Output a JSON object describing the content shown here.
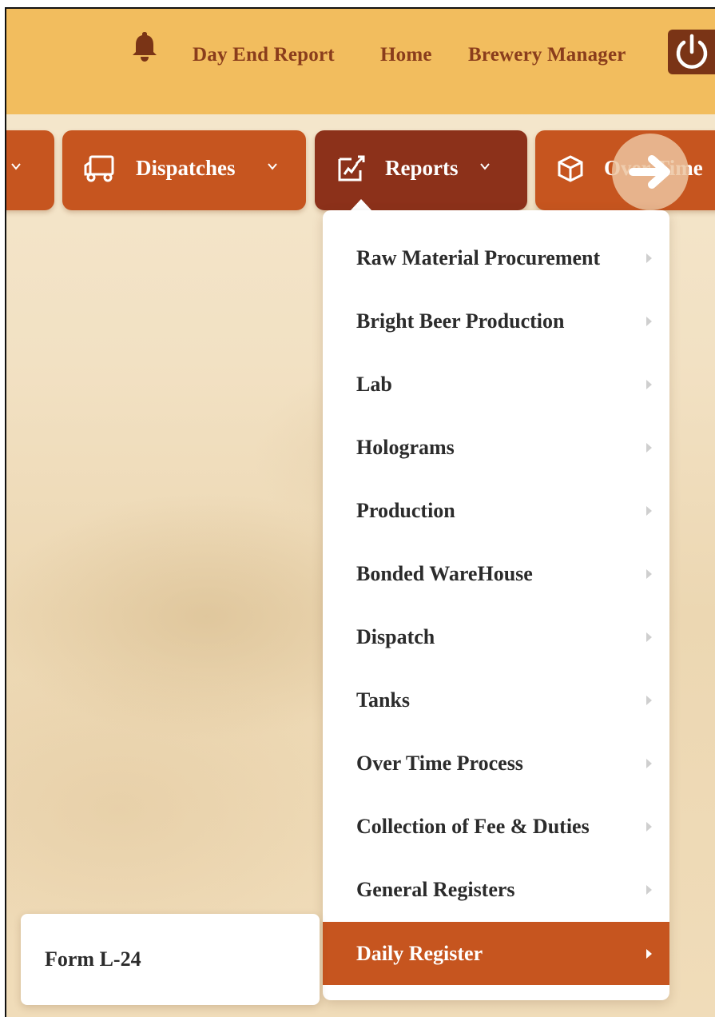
{
  "header": {
    "links": [
      "Day End Report",
      "Home",
      "Brewery Manager"
    ],
    "icons": [
      "bell-icon",
      "power-icon"
    ],
    "accent": "#f2bd5e",
    "brand": "#7a3416"
  },
  "navbar": {
    "items": [
      {
        "label": "Dispatches",
        "icon": "truck-icon"
      },
      {
        "label": "Reports",
        "icon": "chart-edit-icon"
      },
      {
        "label": "Over Time",
        "icon": "box-icon"
      }
    ],
    "active": "Reports",
    "button_color": "#c6551f",
    "active_color": "#8c311a"
  },
  "reports_menu": {
    "items": [
      "Raw Material Procurement",
      "Bright Beer Production",
      "Lab",
      "Holograms",
      "Production",
      "Bonded WareHouse",
      "Dispatch",
      "Tanks",
      "Over Time Process",
      "Collection of Fee & Duties",
      "General Registers",
      "Daily Register"
    ],
    "active_item": "Daily Register"
  },
  "submenu": {
    "items": [
      "Form L-24"
    ]
  }
}
